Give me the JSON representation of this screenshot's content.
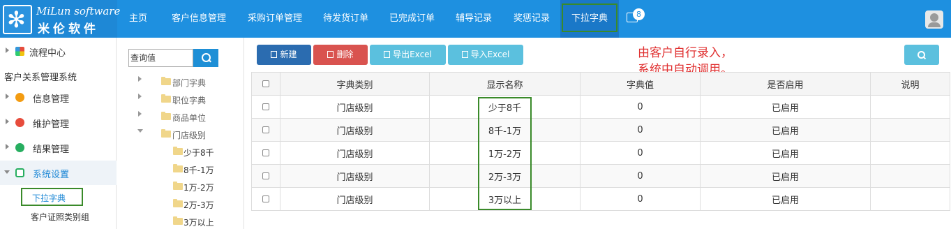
{
  "topnav": {
    "logo": {
      "line1": "MiLun software",
      "line2": "米伦软件"
    },
    "items": [
      "主页",
      "客户信息管理",
      "采购订单管理",
      "待发货订单",
      "已完成订单",
      "辅导记录",
      "奖惩记录",
      "下拉字典"
    ],
    "active": "下拉字典",
    "notification_count": "8"
  },
  "sidebar": {
    "flow_center": "流程中心",
    "system_name": "客户关系管理系统",
    "menus": [
      "信息管理",
      "维护管理",
      "结果管理",
      "系统设置"
    ],
    "sub_items": [
      "下拉字典",
      "客户证照类别组"
    ]
  },
  "tree": {
    "search_placeholder": "查询值",
    "nodes": [
      "部门字典",
      "职位字典",
      "商品单位",
      "门店级别"
    ],
    "children": [
      "少于8千",
      "8千-1万",
      "1万-2万",
      "2万-3万",
      "3万以上"
    ]
  },
  "toolbar": {
    "new": "新建",
    "delete": "删除",
    "export": "导出Excel",
    "import": "导入Excel"
  },
  "note": [
    "由客户自行录入，",
    "系统中自动调用。"
  ],
  "table": {
    "headers": [
      "字典类别",
      "显示名称",
      "字典值",
      "是否启用",
      "说明"
    ],
    "rows": [
      [
        "门店级别",
        "少于8千",
        "0",
        "已启用",
        ""
      ],
      [
        "门店级别",
        "8千-1万",
        "0",
        "已启用",
        ""
      ],
      [
        "门店级别",
        "1万-2万",
        "0",
        "已启用",
        ""
      ],
      [
        "门店级别",
        "2万-3万",
        "0",
        "已启用",
        ""
      ],
      [
        "门店级别",
        "3万以上",
        "0",
        "已启用",
        ""
      ]
    ]
  },
  "colors": {
    "nav": "#1e90e0",
    "highlight": "#3a8a2a",
    "note": "#e03131"
  }
}
